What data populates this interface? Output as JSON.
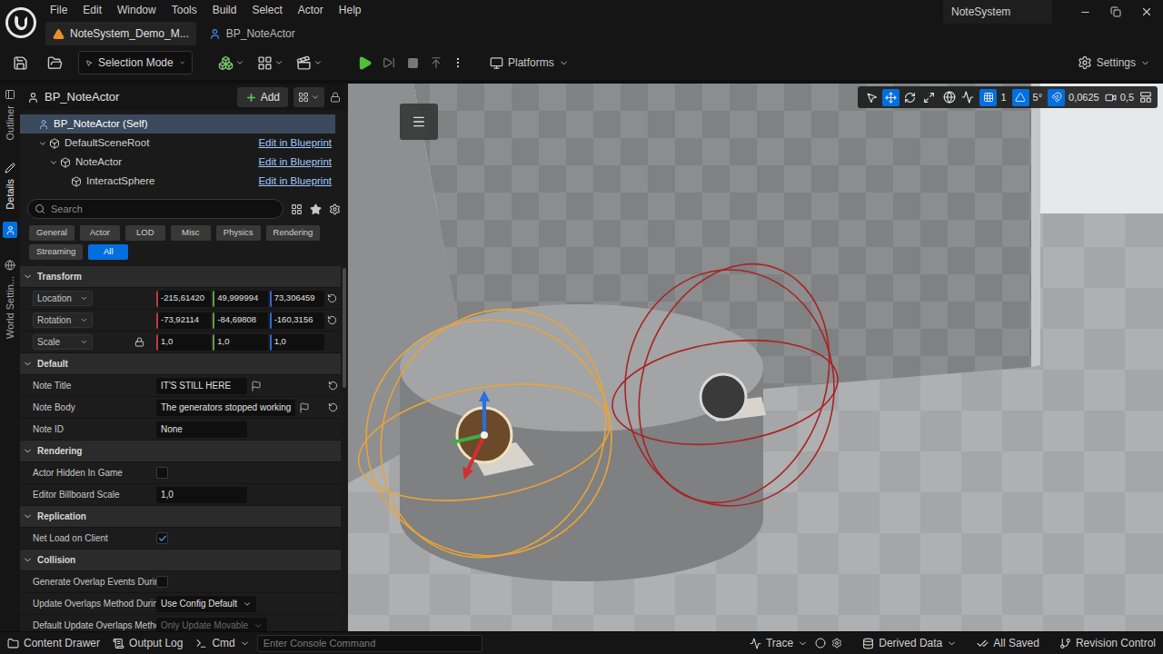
{
  "title_bar": {
    "menu": [
      "File",
      "Edit",
      "Window",
      "Tools",
      "Build",
      "Select",
      "Actor",
      "Help"
    ],
    "tabs": [
      {
        "label": "NoteSystem_Demo_M...",
        "selected": true
      },
      {
        "label": "BP_NoteActor",
        "selected": false
      }
    ],
    "project": "NoteSystem"
  },
  "toolbar": {
    "mode": "Selection Mode",
    "platforms": "Platforms",
    "settings": "Settings"
  },
  "side_tabs": [
    {
      "label": "Outliner",
      "selected": false
    },
    {
      "label": "Details",
      "selected": true
    },
    {
      "label": "World Settin...",
      "selected": false
    }
  ],
  "details": {
    "actor": "BP_NoteActor",
    "add": "Add",
    "tree": {
      "label": "BP_NoteActor (Self)",
      "selected": true,
      "link": "",
      "children": [
        {
          "label": "DefaultSceneRoot",
          "selected": false,
          "expanded": true,
          "link": "Edit in Blueprint",
          "children": [
            {
              "label": "NoteActor",
              "selected": false,
              "expanded": true,
              "link": "Edit in Blueprint",
              "children": [
                {
                  "label": "InteractSphere",
                  "selected": false,
                  "link": "Edit in Blueprint",
                  "children": []
                }
              ]
            }
          ]
        }
      ]
    },
    "search": {
      "placeholder": "Search"
    },
    "filters": [
      {
        "label": "General",
        "selected": false
      },
      {
        "label": "Actor",
        "selected": false
      },
      {
        "label": "LOD",
        "selected": false
      },
      {
        "label": "Misc",
        "selected": false
      },
      {
        "label": "Physics",
        "selected": false
      },
      {
        "label": "Rendering",
        "selected": false
      },
      {
        "label": "Streaming",
        "selected": false
      },
      {
        "label": "All",
        "selected": true
      }
    ],
    "scrollbar": {
      "level": 0.33
    },
    "sections": [
      {
        "title": "Transform",
        "expanded": true,
        "rows": [
          {
            "kind": "vector",
            "label": "Location",
            "dropdown": true,
            "values": [
              "-215,61420",
              "49,999994",
              "73,306459"
            ],
            "modified": true,
            "lock": false
          },
          {
            "kind": "vector",
            "label": "Rotation",
            "dropdown": true,
            "values": [
              "-73,92114",
              "-84,69808",
              "-160,3156"
            ],
            "modified": true,
            "lock": false
          },
          {
            "kind": "vector",
            "label": "Scale",
            "dropdown": true,
            "values": [
              "1,0",
              "1,0",
              "1,0"
            ],
            "modified": false,
            "lock": true
          }
        ]
      },
      {
        "title": "Default",
        "expanded": true,
        "rows": [
          {
            "kind": "text",
            "label": "Note Title",
            "value": "IT'S STILL HERE",
            "localize": true,
            "modified": true
          },
          {
            "kind": "text",
            "label": "Note Body",
            "value": "The generators stopped working",
            "localize": true,
            "modified": true
          },
          {
            "kind": "text",
            "label": "Note ID",
            "value": "None",
            "localize": false,
            "modified": false
          }
        ]
      },
      {
        "title": "Rendering",
        "expanded": true,
        "rows": [
          {
            "kind": "checkbox",
            "label": "Actor Hidden In Game",
            "checked": false
          },
          {
            "kind": "number",
            "label": "Editor Billboard Scale",
            "value": "1,0"
          }
        ]
      },
      {
        "title": "Replication",
        "expanded": true,
        "rows": [
          {
            "kind": "checkbox",
            "label": "Net Load on Client",
            "checked": true
          }
        ]
      },
      {
        "title": "Collision",
        "expanded": true,
        "rows": [
          {
            "kind": "checkbox",
            "label": "Generate Overlap Events Durin...",
            "checked": false
          },
          {
            "kind": "dropdown",
            "label": "Update Overlaps Method Durin...",
            "value": "Use Config Default",
            "disabled": false
          },
          {
            "kind": "dropdown",
            "label": "Default Update Overlaps Metho...",
            "value": "Only Update Movable",
            "disabled": true
          }
        ]
      }
    ]
  },
  "viewport": {
    "tools": [
      {
        "kind": "select",
        "selected": false
      },
      {
        "kind": "translate",
        "selected": true
      },
      {
        "kind": "rotate",
        "selected": false
      },
      {
        "kind": "scale",
        "selected": false
      }
    ],
    "snaps": [
      {
        "kind": "grid",
        "value": "1",
        "on": true
      },
      {
        "kind": "angle",
        "value": "5°",
        "on": true
      },
      {
        "kind": "scale",
        "value": "0,0625",
        "on": true
      }
    ],
    "camera_speed": "0,5"
  },
  "status_bar": {
    "left": [
      "Content Drawer",
      "Output Log"
    ],
    "cmd": "Cmd",
    "console_placeholder": "Enter Console Command",
    "trace": "Trace",
    "right": [
      "Derived Data",
      "All Saved",
      "Revision Control"
    ]
  }
}
